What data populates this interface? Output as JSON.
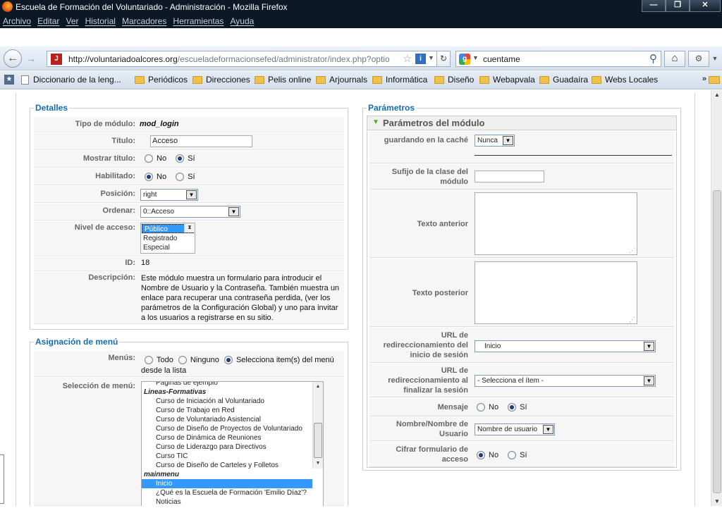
{
  "window": {
    "title": "Escuela de Formación del Voluntariado - Administración - Mozilla Firefox"
  },
  "menubar": [
    "Archivo",
    "Editar",
    "Ver",
    "Historial",
    "Marcadores",
    "Herramientas",
    "Ayuda"
  ],
  "nav": {
    "url_host": "http://voluntariadoalcores.org",
    "url_path": "/escueladeformacionsefed/administrator/index.php?optio",
    "search_engine_icon": "google-icon",
    "search_query": "cuentame"
  },
  "bookmarks": [
    "Diccionario de la leng...",
    "Periódicos",
    "Direcciones",
    "Pelis online",
    "Arjournals",
    "Informática",
    "Diseño",
    "Webapvala",
    "Guadaíra",
    "Webs Locales"
  ],
  "detalles": {
    "legend": "Detalles",
    "tipo_label": "Tipo de módulo:",
    "tipo_value": "mod_login",
    "titulo_label": "Título:",
    "titulo_value": "Acceso",
    "mostrar_label": "Mostrar título:",
    "no": "No",
    "si": "Sí",
    "habilitado_label": "Habilitado:",
    "posicion_label": "Posición:",
    "posicion_value": "right",
    "ordenar_label": "Ordenar:",
    "ordenar_value": "0::Acceso",
    "nivel_label": "Nivel de acceso:",
    "nivel_options": [
      "Público",
      "Registrado",
      "Especial"
    ],
    "id_label": "ID:",
    "id_value": "18",
    "descripcion_label": "Descripción:",
    "descripcion_lines": [
      "Este módulo muestra un formulario para introducir el",
      "Nombre de Usuario y la Contraseña. También muestra un",
      "enlace para recuperar una contraseña perdida, (ver los",
      "parámetros de la Configuración Global) y uno para invitar",
      "a los usuarios a registrarse en su sitio."
    ]
  },
  "menu": {
    "legend": "Asignación de menú",
    "menus_label": "Menús:",
    "todo": "Todo",
    "ninguno": "Ninguno",
    "selecciona": "Selecciona item(s) del menú",
    "selecciona_line2": "desde la lista",
    "seleccion_label": "Selección de menú:",
    "items": [
      {
        "text": "Páginas de ejemplo",
        "kind": "cut"
      },
      {
        "text": "Lineas-Formativas",
        "kind": "group"
      },
      {
        "text": "Curso de Iniciación al Voluntariado",
        "kind": "item"
      },
      {
        "text": "Curso de Trabajo en Red",
        "kind": "item"
      },
      {
        "text": "Curso de Voluntariado Asistencial",
        "kind": "item"
      },
      {
        "text": "Curso de Diseño de Proyectos de Voluntariado",
        "kind": "item"
      },
      {
        "text": "Curso de Dinámica de Reuniones",
        "kind": "item"
      },
      {
        "text": "Curso de Liderazgo para Directivos",
        "kind": "item"
      },
      {
        "text": "Curso TIC",
        "kind": "item"
      },
      {
        "text": "Curso de Diseño de Carteles y Folletos",
        "kind": "item"
      },
      {
        "text": "mainmenu",
        "kind": "group"
      },
      {
        "text": "Inicio",
        "kind": "selected"
      },
      {
        "text": "¿Qué es la Escuela de Formación 'Emilio Díaz'?",
        "kind": "item"
      },
      {
        "text": "Noticias",
        "kind": "item"
      }
    ]
  },
  "parametros": {
    "legend": "Parámetros",
    "section": "Parámetros del módulo",
    "cache_label": "guardando en la caché",
    "cache_value": "Nunca",
    "sufijo_label": "Sufijo de la clase del módulo",
    "anterior_label": "Texto anterior",
    "posterior_label": "Texto posterior",
    "url_inicio_label": "URL de redireccionamiento del inicio de sesión",
    "url_inicio_value": "Inicio",
    "url_fin_label": "URL de redireccionamiento al finalizar la sesión",
    "url_fin_value": "- Selecciona el ítem -",
    "mensaje_label": "Mensaje",
    "nombre_label": "Nombre/Nombre de Usuario",
    "nombre_value": "Nombre de usuario",
    "cifrar_label": "Cifrar formulario de acceso",
    "no": "No",
    "si": "Sí"
  }
}
